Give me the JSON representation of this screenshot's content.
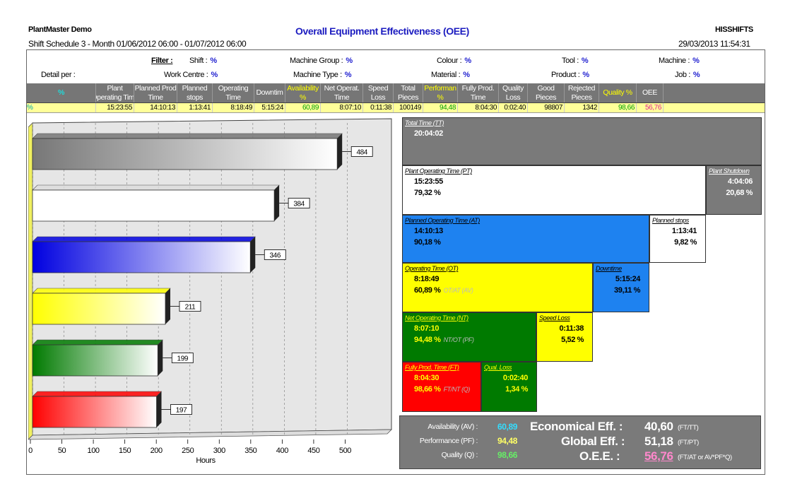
{
  "header": {
    "app_name": "PlantMaster Demo",
    "title": "Overall Equipment Effectiveness (OEE)",
    "shift": "HISSHIFTS",
    "schedule": "Shift Schedule 3 - Month  01/06/2012 06:00 - 01/07/2012 06:00",
    "timestamp": "29/03/2013 11:54:31"
  },
  "filter": {
    "label": "Filter :",
    "detail_label": "Detail per :",
    "shift_label": "Shift :",
    "shift": "%",
    "machine_group_label": "Machine Group :",
    "machine_group": "%",
    "colour_label": "Colour :",
    "colour": "%",
    "tool_label": "Tool :",
    "tool": "%",
    "machine_label": "Machine :",
    "machine": "%",
    "work_centre_label": "Work Centre :",
    "work_centre": "%",
    "machine_type_label": "Machine Type :",
    "machine_type": "%",
    "material_label": "Material :",
    "material": "%",
    "product_label": "Product :",
    "product": "%",
    "job_label": "Job :",
    "job": "%"
  },
  "table": {
    "columns": [
      {
        "label": "%",
        "style": "c"
      },
      {
        "label": "Plant\nOperating Time",
        "style": ""
      },
      {
        "label": "Planned Prod\nTime",
        "style": ""
      },
      {
        "label": "Planned\nstops",
        "style": ""
      },
      {
        "label": "Operating\nTime",
        "style": ""
      },
      {
        "label": "Downtim",
        "style": ""
      },
      {
        "label": "Availability\n%",
        "style": "y"
      },
      {
        "label": "Net Operat.\nTime",
        "style": ""
      },
      {
        "label": "Speed\nLoss",
        "style": ""
      },
      {
        "label": "Total\nPieces",
        "style": ""
      },
      {
        "label": "Performan\n%",
        "style": "y"
      },
      {
        "label": "Fully Prod.\nTime",
        "style": ""
      },
      {
        "label": "Quality\nLoss",
        "style": ""
      },
      {
        "label": "Good\nPieces",
        "style": ""
      },
      {
        "label": "Rejected\nPieces",
        "style": ""
      },
      {
        "label": "Quality %",
        "style": "y"
      },
      {
        "label": "OEE",
        "style": ""
      }
    ],
    "values": [
      {
        "text": "%",
        "style": "c"
      },
      {
        "text": "15:23:55",
        "style": ""
      },
      {
        "text": "14:10:13",
        "style": ""
      },
      {
        "text": "1:13:41",
        "style": ""
      },
      {
        "text": "8:18:49",
        "style": ""
      },
      {
        "text": "5:15:24",
        "style": ""
      },
      {
        "text": "60,89",
        "style": "g"
      },
      {
        "text": "8:07:10",
        "style": ""
      },
      {
        "text": "0:11:38",
        "style": ""
      },
      {
        "text": "100149",
        "style": ""
      },
      {
        "text": "94,48",
        "style": "g"
      },
      {
        "text": "8:04:30",
        "style": ""
      },
      {
        "text": "0:02:40",
        "style": ""
      },
      {
        "text": "98807",
        "style": ""
      },
      {
        "text": "1342",
        "style": ""
      },
      {
        "text": "98,66",
        "style": "g"
      },
      {
        "text": "56,76",
        "style": "m"
      }
    ]
  },
  "chart_data": {
    "type": "bar",
    "orientation": "horizontal",
    "categories": [
      "",
      "",
      "",
      "",
      "",
      ""
    ],
    "values": [
      484,
      384,
      346,
      211,
      199,
      197
    ],
    "colors": [
      "#777777",
      "#ffffff",
      "#0000e0",
      "#ffff00",
      "#007a00",
      "#ff0000"
    ],
    "xlabel": "Hours",
    "xlim": [
      0,
      550
    ],
    "ticks": [
      0,
      50,
      100,
      150,
      200,
      250,
      300,
      350,
      400,
      450,
      500
    ],
    "grid": true
  },
  "blocks": {
    "tt": {
      "title": "Total Time (TT)",
      "v1": "20:04:02"
    },
    "pt": {
      "title": "Plant Operating Time (PT)",
      "v1": "15:23:55",
      "v2": "79,32 %"
    },
    "sd": {
      "title": "Plant Shutdown",
      "v1": "4:04:06",
      "v2": "20,68 %"
    },
    "at": {
      "title": "Planned Operating Time (AT)",
      "v1": "14:10:13",
      "v2": "90,18 %"
    },
    "ps": {
      "title": "Planned stops",
      "v1": "1:13:41",
      "v2": "9,82 %"
    },
    "ot": {
      "title": "Operating Time (OT)",
      "v1": "8:18:49",
      "v2": "60,89 %",
      "formula": "OT/AT (AV)"
    },
    "dt": {
      "title": "Downtime",
      "v1": "5:15:24",
      "v2": "39,11 %"
    },
    "nt": {
      "title": "Net Operating Time (NT)",
      "v1": "8:07:10",
      "v2": "94,48 %",
      "formula": "NT/OT (PF)"
    },
    "sl": {
      "title": "Speed Loss",
      "v1": "0:11:38",
      "v2": "5,52 %"
    },
    "ft": {
      "title": "Fully Prod. Time (FT)",
      "v1": "8:04:30",
      "v2": "98,66 %",
      "formula": "FT/NT (Q)"
    },
    "ql": {
      "title": "Qual. Loss",
      "v1": "0:02:40",
      "v2": "1,34 %"
    }
  },
  "summary": {
    "av_label": "Availability (AV) :",
    "av": "60,89",
    "pf_label": "Performance (PF) :",
    "pf": "94,48",
    "q_label": "Quality (Q) :",
    "q": "98,66",
    "econ_label": "Economical Eff. :",
    "econ": "40,60",
    "econ_f": "(FT/TT)",
    "global_label": "Global Eff. :",
    "global": "51,18",
    "global_f": "(FT/PT)",
    "oee_label": "O.E.E. :",
    "oee": "56,76",
    "oee_f": "(FT/AT or AV*PF*Q)"
  },
  "colors": {
    "header_gray": "#767676",
    "values_row": "#ffff99",
    "tt": "#7a7a7a",
    "pt": "#ffffff",
    "at": "#1e82f0",
    "ot": "#ffff00",
    "dt": "#1e82f0",
    "nt": "#007a00",
    "sl": "#ffff00",
    "ft": "#ff0000",
    "ql": "#007a00",
    "av": "#33ddff",
    "pf": "#ffff66",
    "q": "#66ee66",
    "oee": "#ff88cc"
  }
}
